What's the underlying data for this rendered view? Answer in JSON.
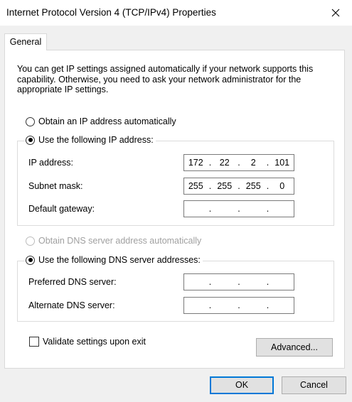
{
  "window": {
    "title": "Internet Protocol Version 4 (TCP/IPv4) Properties",
    "close_icon": "close-icon"
  },
  "tabs": [
    {
      "label": "General",
      "active": true
    }
  ],
  "general": {
    "intro": "You can get IP settings assigned automatically if your network supports this capability. Otherwise, you need to ask your network administrator for the appropriate IP settings.",
    "obtain_ip_auto": {
      "label": "Obtain an IP address automatically",
      "checked": false
    },
    "use_following_ip": {
      "label": "Use the following IP address:",
      "checked": true
    },
    "ip_address": {
      "label": "IP address:",
      "octets": [
        "172",
        "22",
        "2",
        "101"
      ]
    },
    "subnet_mask": {
      "label": "Subnet mask:",
      "octets": [
        "255",
        "255",
        "255",
        "0"
      ]
    },
    "default_gateway": {
      "label": "Default gateway:",
      "octets": [
        "",
        "",
        "",
        ""
      ]
    },
    "obtain_dns_auto": {
      "label": "Obtain DNS server address automatically",
      "checked": false,
      "disabled": true
    },
    "use_following_dns": {
      "label": "Use the following DNS server addresses:",
      "checked": true
    },
    "preferred_dns": {
      "label": "Preferred DNS server:",
      "octets": [
        "",
        "",
        "",
        ""
      ]
    },
    "alternate_dns": {
      "label": "Alternate DNS server:",
      "octets": [
        "",
        "",
        "",
        ""
      ]
    },
    "validate": {
      "label": "Validate settings upon exit",
      "checked": false
    },
    "advanced_label": "Advanced..."
  },
  "buttons": {
    "ok": "OK",
    "cancel": "Cancel"
  },
  "colors": {
    "default_button_border": "#0078d7",
    "background": "#f0f0f0",
    "panel": "#ffffff"
  }
}
